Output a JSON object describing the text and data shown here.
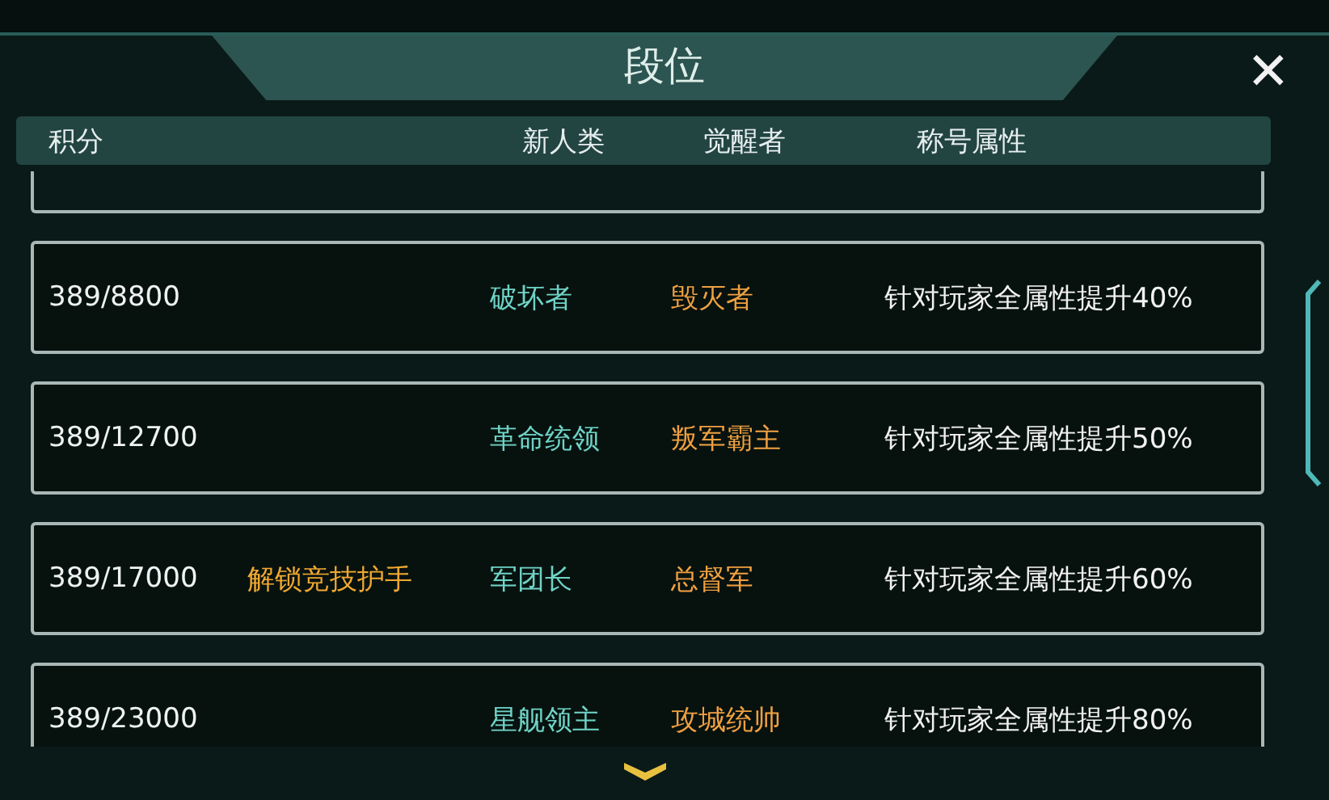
{
  "window": {
    "title": "段位",
    "close": "✕"
  },
  "columns": [
    "积分",
    "新人类",
    "觉醒者",
    "称号属性"
  ],
  "rows": [
    {
      "score": "389/8800",
      "new_human": "破坏者",
      "awakener": "毁灭者",
      "attribute": "针对玩家全属性提升40%"
    },
    {
      "score": "389/12700",
      "new_human": "革命统领",
      "awakener": "叛军霸主",
      "attribute": "针对玩家全属性提升50%"
    },
    {
      "score": "389/17000",
      "unlock": "解锁竞技护手",
      "new_human": "军团长",
      "awakener": "总督军",
      "attribute": "针对玩家全属性提升60%"
    },
    {
      "score": "389/23000",
      "new_human": "星舰领主",
      "awakener": "攻城统帅",
      "attribute": "针对玩家全属性提升80%"
    }
  ]
}
